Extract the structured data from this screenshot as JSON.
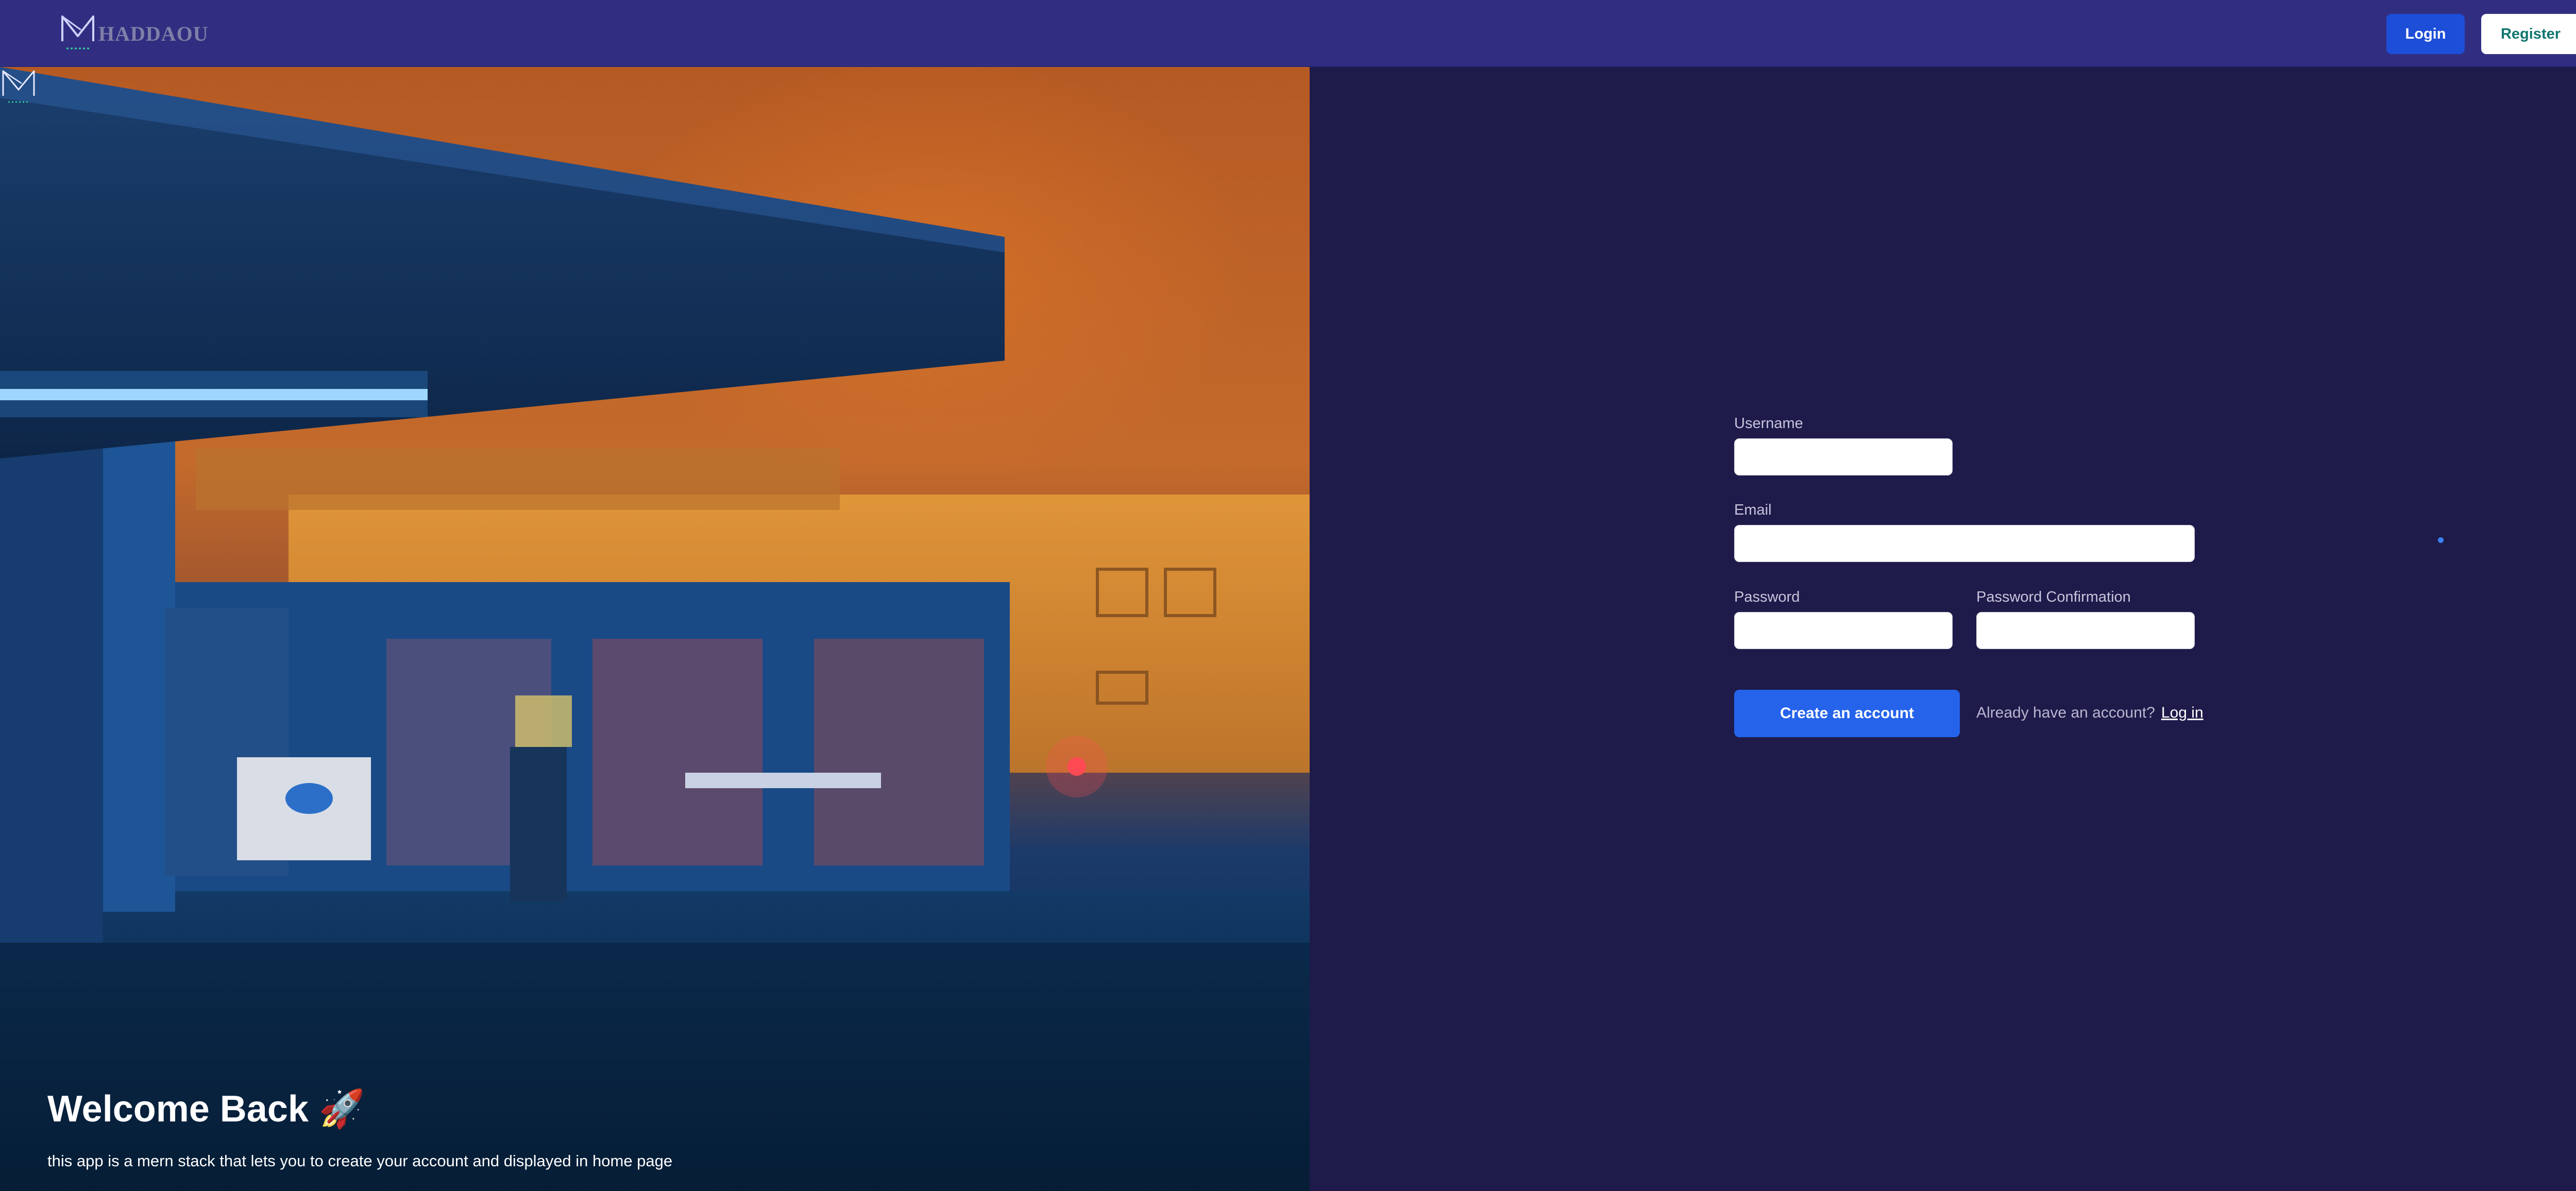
{
  "navbar": {
    "brand_name": "HADDAOU",
    "login_label": "Login",
    "register_label": "Register"
  },
  "hero": {
    "title": "Welcome Back 🚀",
    "subtitle": "this app is a mern stack that lets you to create your account and displayed in home page"
  },
  "form": {
    "username_label": "Username",
    "username_value": "",
    "email_label": "Email",
    "email_value": "",
    "password_label": "Password",
    "password_value": "",
    "password_confirmation_label": "Password Confirmation",
    "password_confirmation_value": "",
    "create_account_label": "Create an account",
    "already_text": "Already have an account?",
    "login_link_label": "Log in"
  },
  "colors": {
    "navbar_bg": "#312e81",
    "page_bg": "#1e1b4b",
    "primary": "#2563eb",
    "register_text": "#0f766e"
  },
  "icons": [
    "haddaou-logo-icon"
  ]
}
